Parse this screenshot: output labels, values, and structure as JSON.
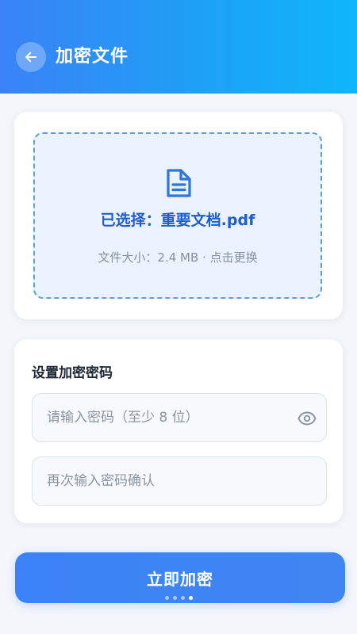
{
  "header": {
    "title": "加密文件",
    "back_icon": "arrow-left-icon"
  },
  "file": {
    "icon": "file-text-icon",
    "selected_text": "已选择：重要文档.pdf",
    "meta_text": "文件大小：2.4 MB · 点击更换"
  },
  "password": {
    "title": "设置加密密码",
    "password_placeholder": "请输入密码（至少 8 位）",
    "password_value": "",
    "confirm_placeholder": "再次输入密码确认",
    "confirm_value": "",
    "visibility_icon": "eye-icon"
  },
  "actions": {
    "submit_label": "立即加密"
  },
  "pager": {
    "total": 4,
    "active_index": 3
  },
  "colors": {
    "primary": "#3b82f6",
    "header_gradient_end": "#0fb6fb",
    "file_text": "#1e5fd0"
  }
}
